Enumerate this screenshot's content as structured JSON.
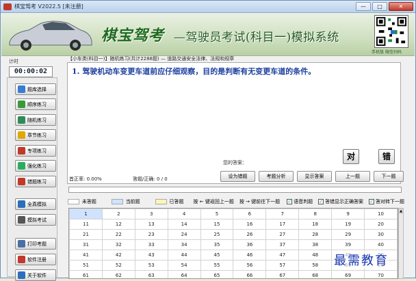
{
  "window": {
    "title": "棋宝驾考 V2022.5 [未注册]",
    "minimize": "—",
    "maximize": "□",
    "close": "✕"
  },
  "banner": {
    "brand": "棋宝驾考",
    "slogan": "—驾驶员考试(科目一)模拟系统",
    "qr_caption": "手机版  微信扫码"
  },
  "timer": {
    "label": "计时",
    "value": "00:00:02"
  },
  "sidebar": {
    "items": [
      {
        "label": "题库选择",
        "icon": "book-icon",
        "color": "#3a7bd5"
      },
      {
        "label": "顺序练习",
        "icon": "list-icon",
        "color": "#3a9a3a"
      },
      {
        "label": "随机练习",
        "icon": "shuffle-icon",
        "color": "#2e8b57"
      },
      {
        "label": "章节练习",
        "icon": "chapter-icon",
        "color": "#e0a800"
      },
      {
        "label": "专项练习",
        "icon": "target-icon",
        "color": "#c0392b"
      },
      {
        "label": "强化练习",
        "icon": "chart-icon",
        "color": "#27ae60"
      },
      {
        "label": "错题练习",
        "icon": "flag-icon",
        "color": "#c0392b"
      },
      {
        "label": "全真模拟",
        "icon": "monitor-icon",
        "color": "#2c6fbb"
      },
      {
        "label": "模拟考试",
        "icon": "exam-icon",
        "color": "#555555"
      },
      {
        "label": "打印考题",
        "icon": "printer-icon",
        "color": "#4a6fa5"
      },
      {
        "label": "软件注册",
        "icon": "key-icon",
        "color": "#c0392b"
      },
      {
        "label": "关于软件",
        "icon": "info-icon",
        "color": "#2c6fbb"
      }
    ]
  },
  "question": {
    "header": "【小车类(科目一)】随机练习(共计2288题) — 道路交通安全法律、法规和规章",
    "text": "1. 驾驶机动车变更车道前应仔细观察，目的是判断有无变更车道的条件。",
    "answer_label": "您的答案：",
    "correct_button": "对",
    "wrong_button": "错"
  },
  "stats": {
    "accuracy": "首正率: 0.00%",
    "answered": "答题/正确: 0 / 0"
  },
  "actions": {
    "favorite": "设为错题",
    "analysis": "考题分析",
    "show_answer": "显示答案",
    "prev": "上一题",
    "next": "下一题"
  },
  "progress": {
    "value": 0
  },
  "legend": {
    "unanswered": "未答题",
    "current": "当前题",
    "answered": "已答题",
    "hint_prev": "按 ← 键返回上一题",
    "hint_next": "按 → 键前往下一题",
    "voice": "语音判题",
    "show_correct": "答错显示正确答案",
    "auto_next": "答对转下一题",
    "colors": {
      "unanswered": "#ffffff",
      "current": "#cfe3ff",
      "answered": "#fff6b8"
    }
  },
  "grid": {
    "rows": [
      [
        "1",
        "2",
        "3",
        "4",
        "5",
        "6",
        "7",
        "8",
        "9",
        "10"
      ],
      [
        "11",
        "12",
        "13",
        "14",
        "15",
        "16",
        "17",
        "18",
        "19",
        "20"
      ],
      [
        "21",
        "22",
        "23",
        "24",
        "25",
        "26",
        "27",
        "28",
        "29",
        "30"
      ],
      [
        "31",
        "32",
        "33",
        "34",
        "35",
        "36",
        "37",
        "38",
        "39",
        "40"
      ],
      [
        "41",
        "42",
        "43",
        "44",
        "45",
        "46",
        "47",
        "48",
        "49",
        "50"
      ],
      [
        "51",
        "52",
        "53",
        "54",
        "55",
        "56",
        "57",
        "58",
        "59",
        "60"
      ],
      [
        "61",
        "62",
        "63",
        "64",
        "65",
        "66",
        "67",
        "68",
        "69",
        "70"
      ]
    ]
  },
  "watermark": "最需教育"
}
